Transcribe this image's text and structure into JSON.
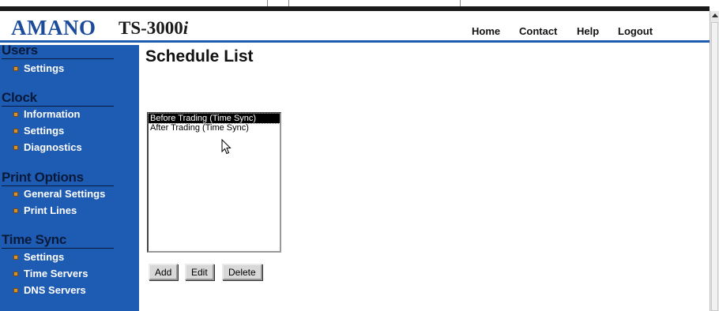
{
  "header": {
    "brand": "AMANO",
    "model_prefix": "TS-3000",
    "model_suffix": "i",
    "nav": [
      "Home",
      "Contact",
      "Help",
      "Logout"
    ]
  },
  "sidebar": {
    "sections": [
      {
        "title": "Users",
        "items": [
          "Settings"
        ]
      },
      {
        "title": "Clock",
        "items": [
          "Information",
          "Settings",
          "Diagnostics"
        ]
      },
      {
        "title": "Print Options",
        "items": [
          "General Settings",
          "Print Lines"
        ]
      },
      {
        "title": "Time Sync",
        "items": [
          "Settings",
          "Time Servers",
          "DNS Servers"
        ]
      }
    ]
  },
  "main": {
    "title": "Schedule List",
    "schedules": [
      "Before Trading (Time Sync)",
      "After Trading (Time Sync)"
    ],
    "selected_index": 0,
    "buttons": {
      "add": "Add",
      "edit": "Edit",
      "delete": "Delete"
    }
  },
  "colors": {
    "sidebar_bg": "#1e5bb3",
    "brand_text": "#1d4b9c",
    "bullet": "#d8902a"
  }
}
